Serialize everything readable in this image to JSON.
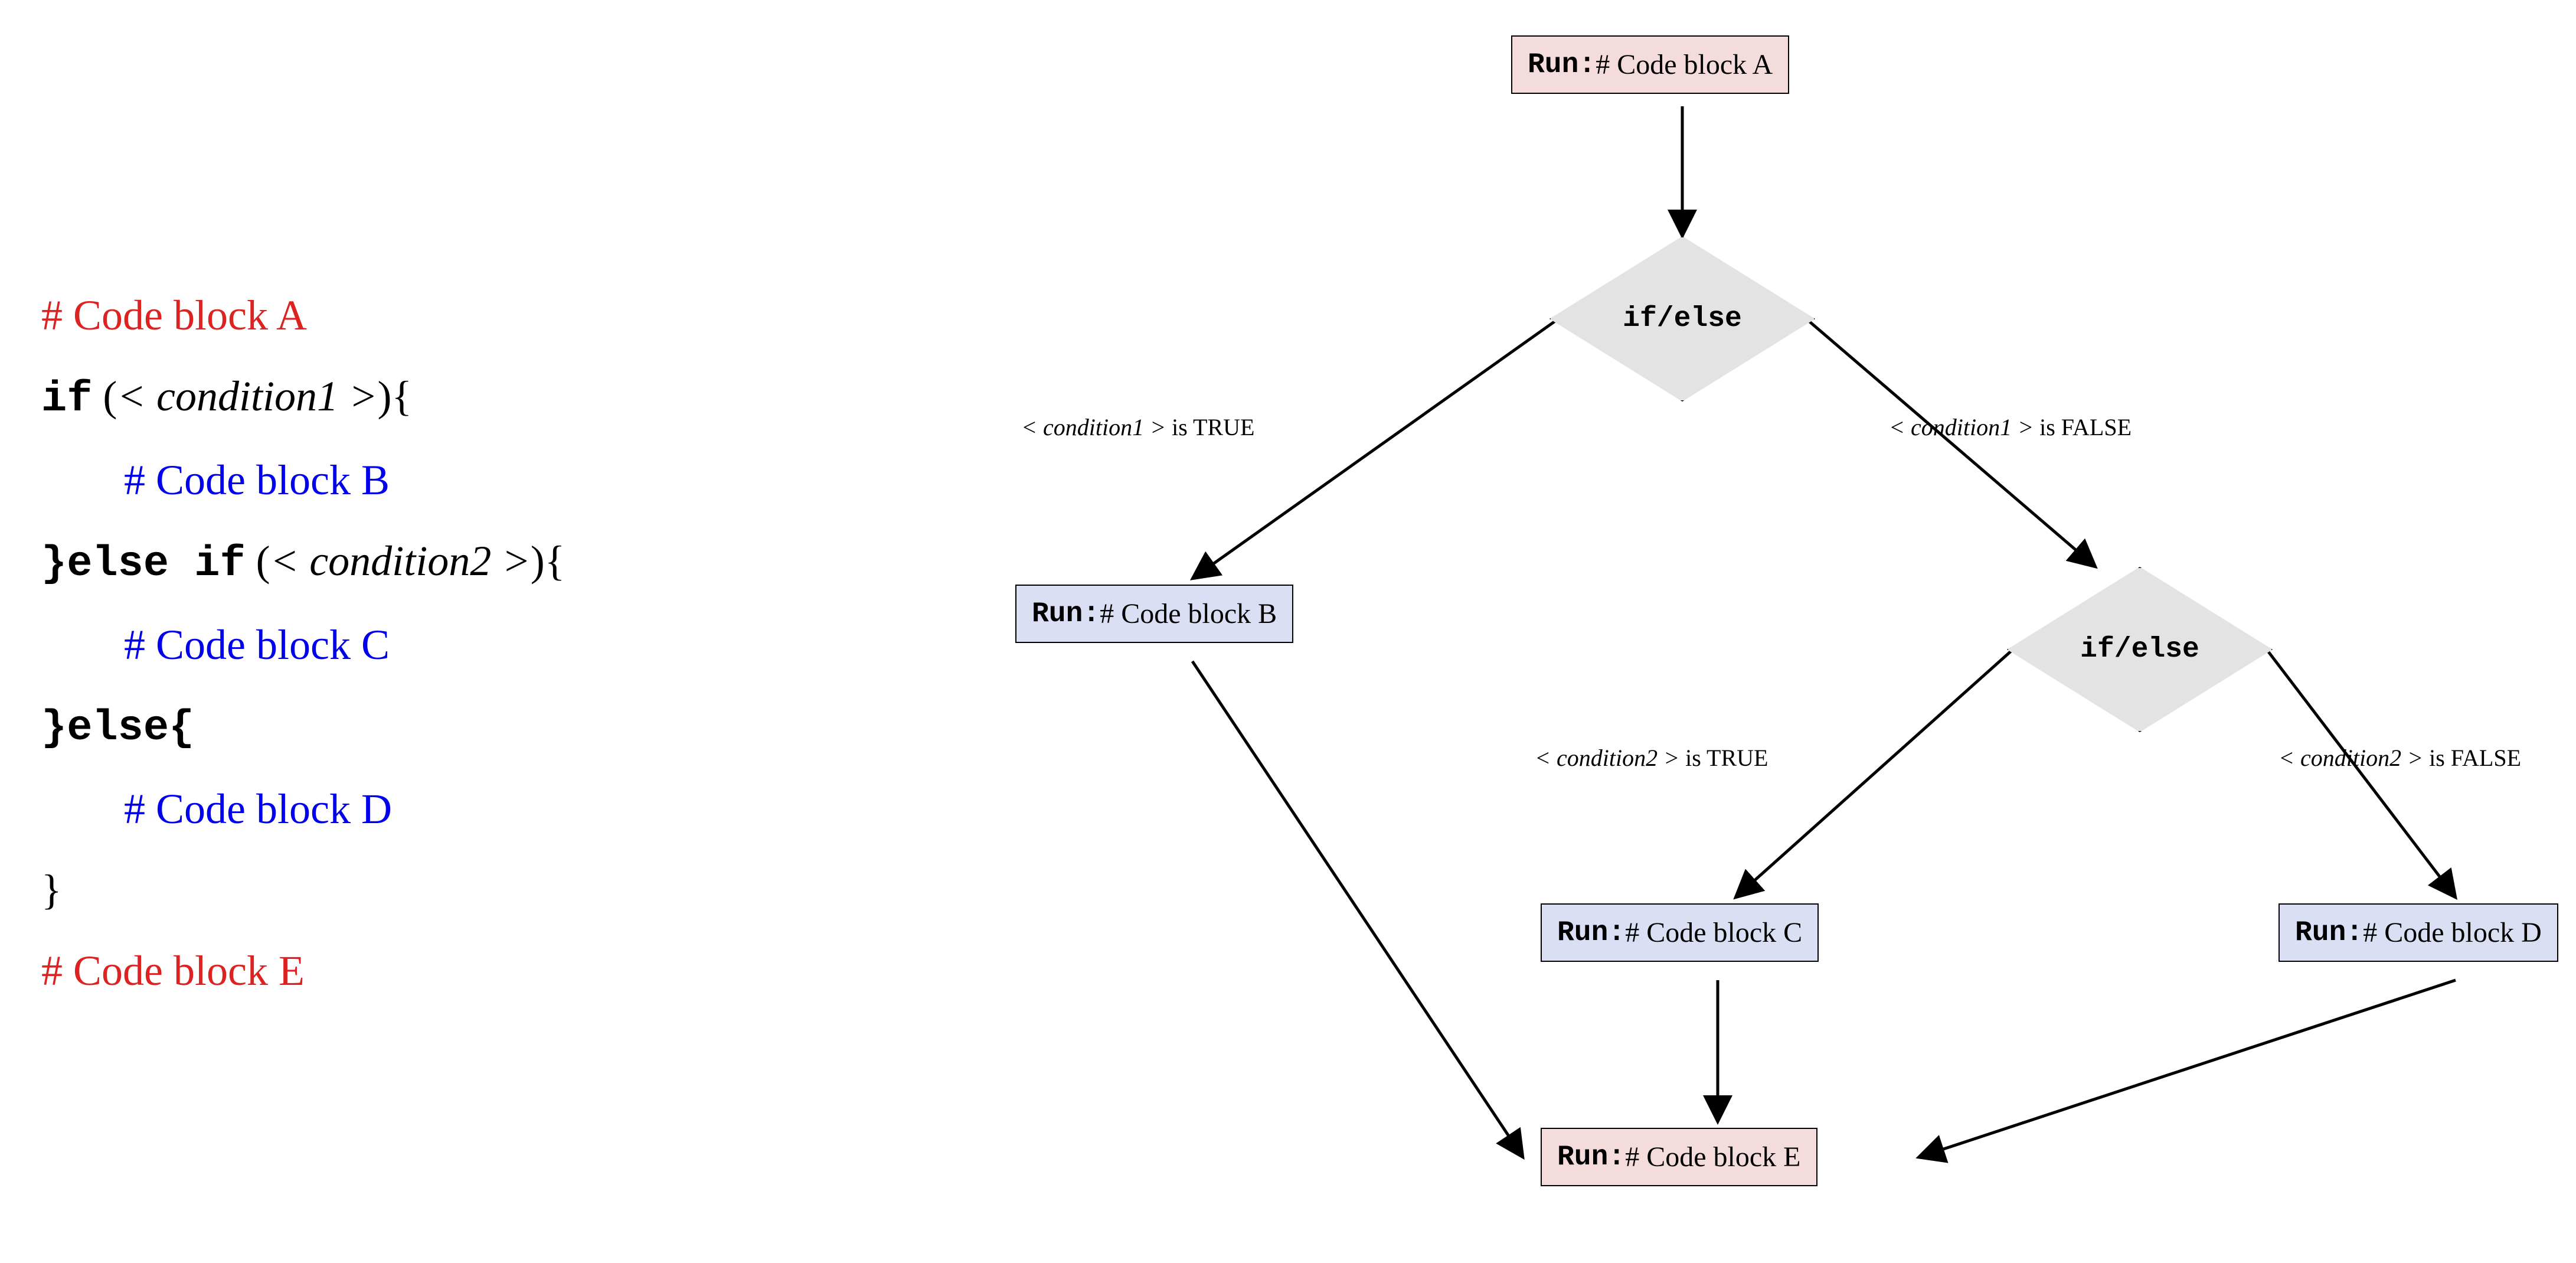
{
  "code": {
    "line1": "# Code block A",
    "line2_if": "if",
    "line2_cond": "< condition1 >",
    "line2_brace": "{",
    "line3": "# Code block B",
    "line4_else_if": "}else if",
    "line4_cond": "< condition2 >",
    "line4_brace": "{",
    "line5": "# Code block C",
    "line6_else": "}else{",
    "line7": "# Code block D",
    "line8_brace": "}",
    "line9": "# Code block E"
  },
  "flow": {
    "nodeA_run": "Run:",
    "nodeA_text": " # Code block A",
    "decision1": "if/else",
    "edge1_true_cond": "< condition1 >",
    "edge1_true_text": " is TRUE",
    "edge1_false_cond": "< condition1 >",
    "edge1_false_text": " is FALSE",
    "nodeB_run": "Run:",
    "nodeB_text": " # Code block B",
    "decision2": "if/else",
    "edge2_true_cond": "< condition2 >",
    "edge2_true_text": " is TRUE",
    "edge2_false_cond": "< condition2 >",
    "edge2_false_text": " is FALSE",
    "nodeC_run": "Run:",
    "nodeC_text": " # Code block C",
    "nodeD_run": "Run:",
    "nodeD_text": " # Code block D",
    "nodeE_run": "Run:",
    "nodeE_text": " # Code block E"
  }
}
